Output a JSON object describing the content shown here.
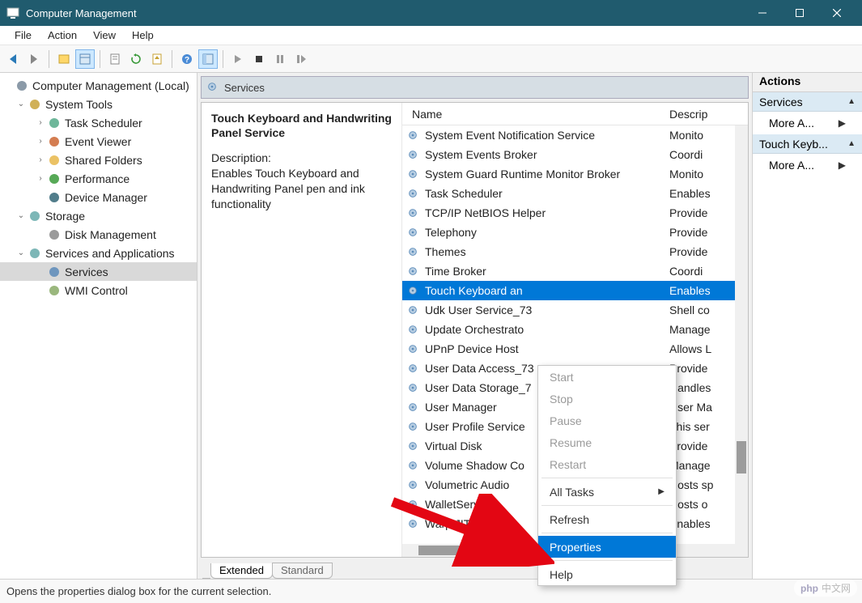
{
  "window": {
    "title": "Computer Management"
  },
  "menubar": [
    "File",
    "Action",
    "View",
    "Help"
  ],
  "tree": [
    {
      "label": "Computer Management (Local)",
      "depth": 0,
      "toggle": "",
      "icon": "computer"
    },
    {
      "label": "System Tools",
      "depth": 1,
      "toggle": "v",
      "icon": "wrench"
    },
    {
      "label": "Task Scheduler",
      "depth": 2,
      "toggle": ">",
      "icon": "clock"
    },
    {
      "label": "Event Viewer",
      "depth": 2,
      "toggle": ">",
      "icon": "event"
    },
    {
      "label": "Shared Folders",
      "depth": 2,
      "toggle": ">",
      "icon": "folder-share"
    },
    {
      "label": "Performance",
      "depth": 2,
      "toggle": ">",
      "icon": "perf"
    },
    {
      "label": "Device Manager",
      "depth": 2,
      "toggle": "",
      "icon": "device"
    },
    {
      "label": "Storage",
      "depth": 1,
      "toggle": "v",
      "icon": "storage"
    },
    {
      "label": "Disk Management",
      "depth": 2,
      "toggle": "",
      "icon": "disk"
    },
    {
      "label": "Services and Applications",
      "depth": 1,
      "toggle": "v",
      "icon": "services-app"
    },
    {
      "label": "Services",
      "depth": 2,
      "toggle": "",
      "icon": "gear",
      "selected": true
    },
    {
      "label": "WMI Control",
      "depth": 2,
      "toggle": "",
      "icon": "wmi"
    }
  ],
  "services_panel": {
    "header": "Services",
    "selected_title": "Touch Keyboard and Handwriting Panel Service",
    "desc_label": "Description:",
    "description": "Enables Touch Keyboard and Handwriting Panel pen and ink functionality",
    "columns": {
      "name": "Name",
      "desc": "Descrip"
    },
    "rows": [
      {
        "name": "System Event Notification Service",
        "desc": "Monito"
      },
      {
        "name": "System Events Broker",
        "desc": "Coordi"
      },
      {
        "name": "System Guard Runtime Monitor Broker",
        "desc": "Monito"
      },
      {
        "name": "Task Scheduler",
        "desc": "Enables"
      },
      {
        "name": "TCP/IP NetBIOS Helper",
        "desc": "Provide"
      },
      {
        "name": "Telephony",
        "desc": "Provide"
      },
      {
        "name": "Themes",
        "desc": "Provide"
      },
      {
        "name": "Time Broker",
        "desc": "Coordi"
      },
      {
        "name": "Touch Keyboard an",
        "desc": "Enables",
        "selected": true
      },
      {
        "name": "Udk User Service_73",
        "desc": "Shell co"
      },
      {
        "name": "Update Orchestrato",
        "desc": "Manage"
      },
      {
        "name": "UPnP Device Host",
        "desc": "Allows L"
      },
      {
        "name": "User Data Access_73",
        "desc": "Provide"
      },
      {
        "name": "User Data Storage_7",
        "desc": "Handles"
      },
      {
        "name": "User Manager",
        "desc": "User Ma"
      },
      {
        "name": "User Profile Service",
        "desc": "This ser"
      },
      {
        "name": "Virtual Disk",
        "desc": "Provide"
      },
      {
        "name": "Volume Shadow Co",
        "desc": "Manage"
      },
      {
        "name": "Volumetric Audio",
        "desc": "Hosts sp"
      },
      {
        "name": "WalletService",
        "desc": "Hosts o"
      },
      {
        "name": "Warp JIT Service",
        "desc": "Enables"
      }
    ],
    "tabs": [
      "Extended",
      "Standard"
    ]
  },
  "context_menu": [
    {
      "label": "Start",
      "disabled": true
    },
    {
      "label": "Stop",
      "disabled": true
    },
    {
      "label": "Pause",
      "disabled": true
    },
    {
      "label": "Resume",
      "disabled": true
    },
    {
      "label": "Restart",
      "disabled": true
    },
    {
      "sep": true
    },
    {
      "label": "All Tasks",
      "submenu": true
    },
    {
      "sep": true
    },
    {
      "label": "Refresh"
    },
    {
      "sep": true
    },
    {
      "label": "Properties",
      "selected": true
    },
    {
      "sep": true
    },
    {
      "label": "Help"
    }
  ],
  "actions": {
    "title": "Actions",
    "sections": [
      {
        "header": "Services",
        "items": [
          "More A..."
        ]
      },
      {
        "header": "Touch Keyb...",
        "items": [
          "More A..."
        ]
      }
    ]
  },
  "statusbar": "Opens the properties dialog box for the current selection.",
  "watermark": {
    "php": "php",
    "cn": "中文网"
  }
}
